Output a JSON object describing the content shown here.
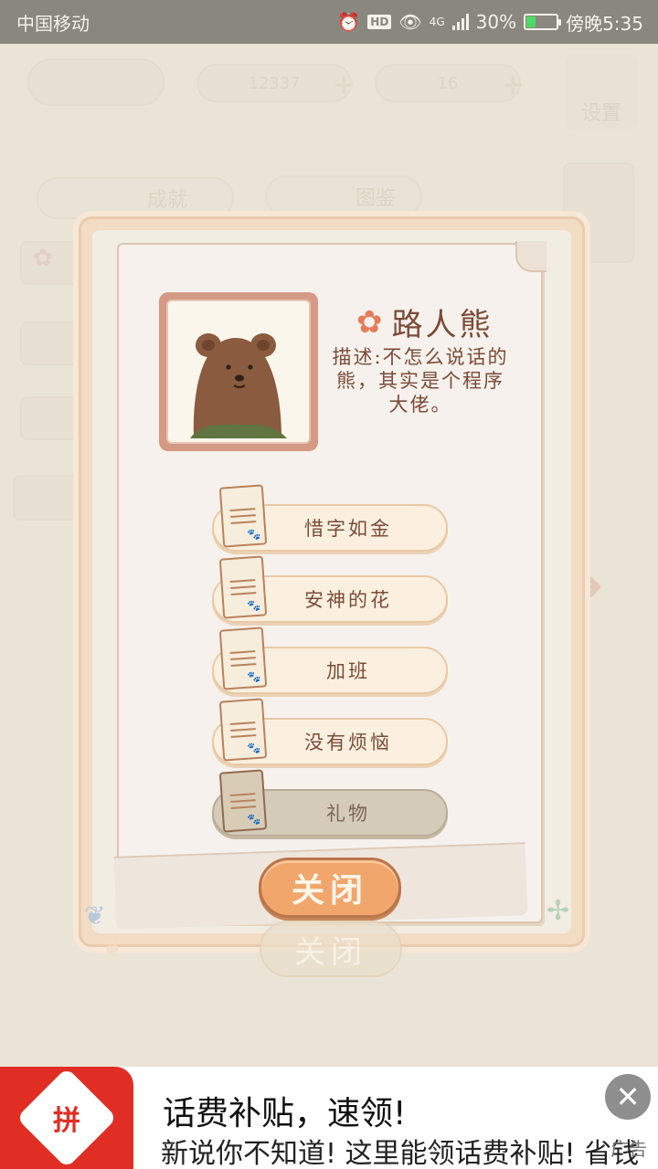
{
  "status_bar": {
    "carrier": "中国移动",
    "network": "4G",
    "battery": "30%",
    "battery_level": 0.3,
    "time": "傍晚5:35",
    "icons": [
      "alarm-icon",
      "hd-icon",
      "eye-icon",
      "signal-icon",
      "battery-icon"
    ]
  },
  "background": {
    "coins": "12337",
    "fish": "16",
    "settings_label": "设置",
    "tabs": [
      "成就",
      "图鉴"
    ]
  },
  "character": {
    "name": "路人熊",
    "description": "描述:不怎么说话的熊，其实是个程序大佬。"
  },
  "stories": [
    {
      "label": "惜字如金",
      "locked": false
    },
    {
      "label": "安神的花",
      "locked": false
    },
    {
      "label": "加班",
      "locked": false
    },
    {
      "label": "没有烦恼",
      "locked": false
    },
    {
      "label": "礼物",
      "locked": true
    }
  ],
  "close_label": "关闭",
  "ad": {
    "logo": "拼",
    "title": "话费补贴，速领!",
    "subtitle": "新说你不知道! 这里能领话费补贴! 省钱",
    "label": "广告"
  },
  "colors": {
    "accent_orange": "#f1a66c",
    "text_brown": "#7b4b38",
    "ad_red": "#e02e24"
  }
}
